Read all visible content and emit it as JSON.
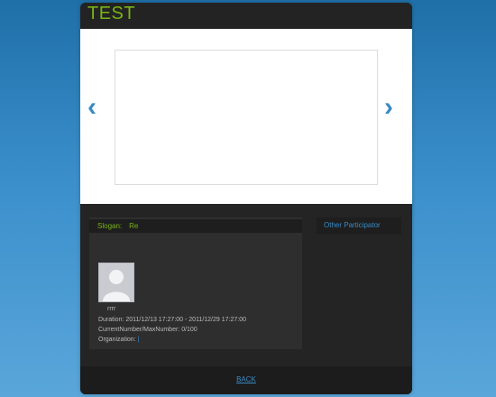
{
  "header": {
    "title": "TEST"
  },
  "carousel": {
    "prev_icon": "‹",
    "next_icon": "›"
  },
  "detail": {
    "slogan_label": "Slogan:",
    "slogan_value": "Re",
    "user_name": "rrrr",
    "duration": "Duration: 2011/12/13 17:27:00 - 2011/12/29 17:27:00",
    "current_number": "CurrentNumber/MaxNumber: 0/100",
    "organization_label": "Organization:",
    "organization_value": "|"
  },
  "side": {
    "title": "Other Participator"
  },
  "footer": {
    "back_label": "BACK"
  },
  "colors": {
    "accent_green": "#79b417",
    "link_blue": "#3a8ac4",
    "panel_dark": "#242424"
  }
}
